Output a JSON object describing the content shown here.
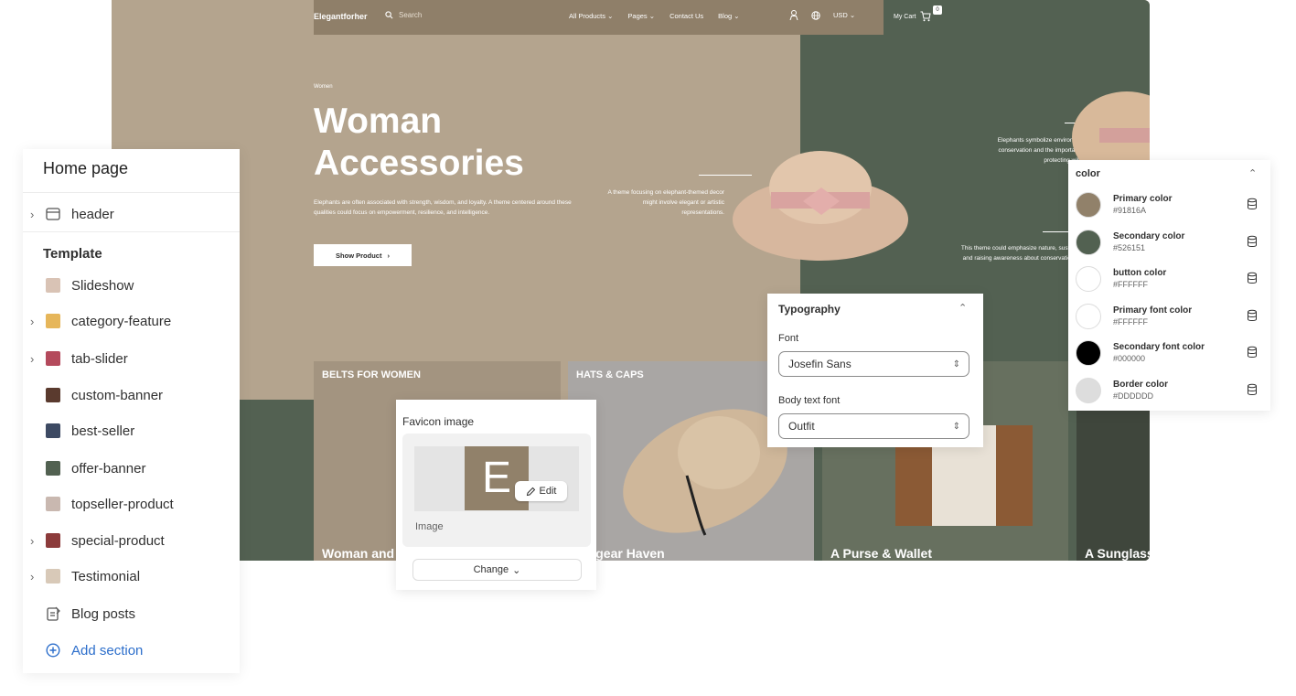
{
  "store": {
    "logo": "Elegantforher",
    "search_placeholder": "Search",
    "menu": [
      "All Products",
      "Pages",
      "Contact Us",
      "Blog"
    ],
    "currency": "USD",
    "cart_label": "My Cart",
    "cart_count": "0",
    "hero": {
      "eyebrow": "Women",
      "title": "Woman Accessories",
      "body": "Elephants are often associated with strength, wisdom, and loyalty. A theme centered around these qualities could focus on empowerment, resilience, and intelligence.",
      "button": "Show Product",
      "quote": "A theme focusing on elephant-themed decor might involve elegant or artistic representations.",
      "quote2": "Elephants symbolize environmental conservation and the importance of protecting wildlife.",
      "quote3": "This theme could emphasize nature, sustainability, and raising awareness about conservation efforts."
    },
    "categories": [
      {
        "label": "BELTS FOR WOMEN",
        "title": "Woman and Belts"
      },
      {
        "label": "HATS & CAPS",
        "title": "Headgear Haven"
      },
      {
        "label": "",
        "title": "A Purse & Wallet"
      },
      {
        "label": "",
        "title": "A Sunglasses"
      }
    ]
  },
  "sidebar": {
    "title": "Home page",
    "header_item": "header",
    "template_heading": "Template",
    "items": [
      {
        "label": "Slideshow",
        "expandable": false,
        "thumb_color": "#d9c3b5"
      },
      {
        "label": "category-feature",
        "expandable": true,
        "thumb_color": "#e6b65a"
      },
      {
        "label": "tab-slider",
        "expandable": true,
        "thumb_color": "#b44a5c"
      },
      {
        "label": "custom-banner",
        "expandable": false,
        "thumb_color": "#5a3a2e"
      },
      {
        "label": "best-seller",
        "expandable": false,
        "thumb_color": "#3d4a63"
      },
      {
        "label": "offer-banner",
        "expandable": false,
        "thumb_color": "#526151"
      },
      {
        "label": "topseller-product",
        "expandable": false,
        "thumb_color": "#c9b8b0"
      },
      {
        "label": "special-product",
        "expandable": true,
        "thumb_color": "#8c3b3b"
      },
      {
        "label": "Testimonial",
        "expandable": true,
        "thumb_color": "#d8c9b8"
      },
      {
        "label": "Blog posts",
        "expandable": false,
        "thumb_color": ""
      }
    ],
    "add_section": "Add section"
  },
  "favicon": {
    "title": "Favicon image",
    "letter": "E",
    "edit": "Edit",
    "image_label": "Image",
    "change": "Change"
  },
  "typography": {
    "title": "Typography",
    "font_label": "Font",
    "font_value": "Josefin Sans",
    "body_label": "Body text font",
    "body_value": "Outfit"
  },
  "colors": {
    "title": "color",
    "items": [
      {
        "name": "Primary color",
        "hex": "#91816A"
      },
      {
        "name": "Secondary color",
        "hex": "#526151"
      },
      {
        "name": "button color",
        "hex": "#FFFFFF"
      },
      {
        "name": "Primary font color",
        "hex": "#FFFFFF"
      },
      {
        "name": "Secondary font color",
        "hex": "#000000"
      },
      {
        "name": "Border color",
        "hex": "#DDDDDD"
      }
    ]
  }
}
